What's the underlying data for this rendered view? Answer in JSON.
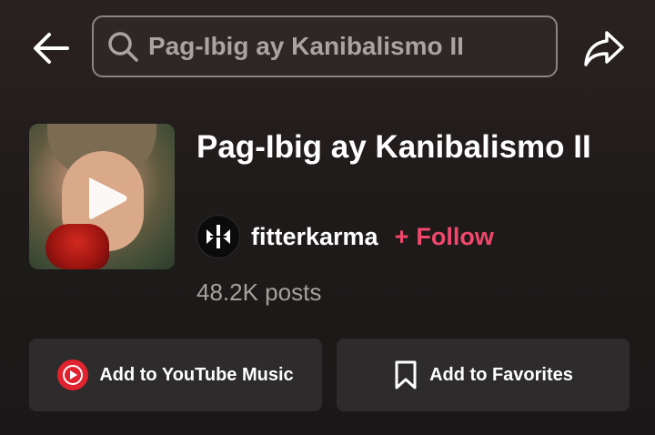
{
  "search": {
    "value": "Pag-Ibig ay Kanibalismo II",
    "icon": "search-icon"
  },
  "nav": {
    "back_icon": "arrow-left-icon",
    "share_icon": "share-icon"
  },
  "track": {
    "title": "Pag-Ibig ay Kanibalismo II",
    "artist": "fitterkarma",
    "follow_label": "Follow",
    "follow_prefix": "+",
    "posts": "48.2K posts"
  },
  "actions": {
    "youtube_music_label": "Add to YouTube Music",
    "favorites_label": "Add to Favorites"
  },
  "colors": {
    "accent": "#f0476b",
    "youtube_red": "#e0232e",
    "button_bg": "#2d2b2b",
    "muted_text": "#a4a19f"
  }
}
